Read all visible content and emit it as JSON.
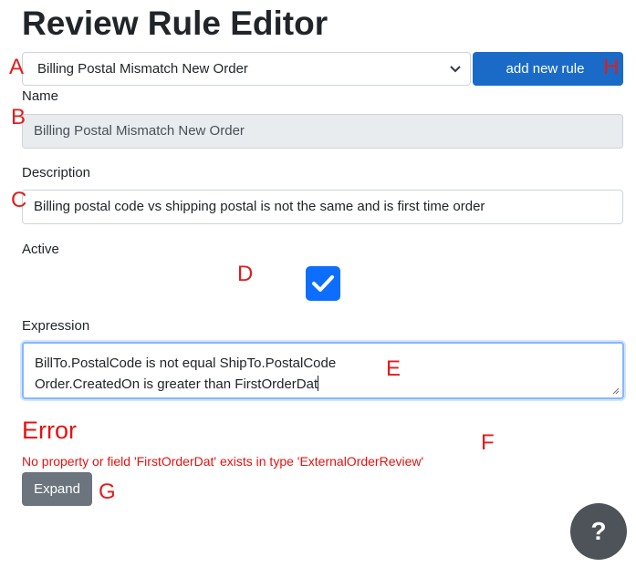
{
  "page": {
    "title": "Review Rule Editor"
  },
  "rule_select": {
    "selected": "Billing Postal Mismatch New Order"
  },
  "toolbar": {
    "add_rule_label": "add new rule"
  },
  "form": {
    "name_label": "Name",
    "name_value": "Billing Postal Mismatch New Order",
    "description_label": "Description",
    "description_value": "Billing postal code vs shipping postal is not the same and is first time order",
    "active_label": "Active",
    "active_checked": true,
    "expression_label": "Expression",
    "expression_lines": [
      "BillTo.PostalCode is not equal ShipTo.PostalCode",
      "Order.CreatedOn is greater than FirstOrderDat"
    ]
  },
  "error": {
    "title": "Error",
    "message": "No property or field 'FirstOrderDat' exists in type 'ExternalOrderReview'",
    "expand_label": "Expand"
  },
  "help": {
    "label": "?"
  },
  "annotations": {
    "a": "A",
    "b": "B",
    "c": "C",
    "d": "D",
    "e": "E",
    "f": "F",
    "g": "G",
    "h": "H"
  },
  "colors": {
    "primary": "#1a6bc8",
    "checkbox": "#0d6efd",
    "error": "#e81010",
    "secondary": "#6c757d",
    "help_bg": "#4d5359",
    "annotation": "#e21c1c"
  }
}
